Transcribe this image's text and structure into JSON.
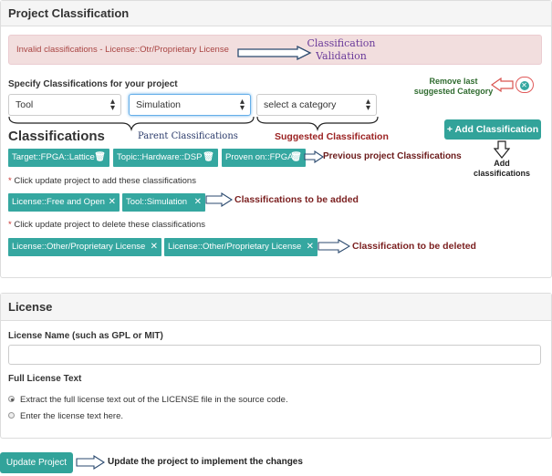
{
  "panel": {
    "title": "Project Classification",
    "alert_text": "Invalid classifications - License::Otr/Proprietary License",
    "specify_label": "Specify Classifications for your project",
    "selects": [
      {
        "value": "Tool"
      },
      {
        "value": "Simulation"
      },
      {
        "value": "select a category"
      }
    ],
    "classifications_heading": "Classifications",
    "add_button": "+ Add Classification",
    "previous_tags": [
      "Target::FPGA::Lattice",
      "Topic::Hardware::DSP",
      "Proven on::FPGA"
    ],
    "note_add": "Click update project to add these classifications",
    "add_tags": [
      "License::Free and Open",
      "Tool::Simulation"
    ],
    "note_delete": "Click update project to delete these classifications",
    "delete_tags": [
      "License::Other/Proprietary License",
      "License::Other/Proprietary License"
    ]
  },
  "annotations": {
    "validation": "Classification Validation",
    "validation_line1": "Classification",
    "validation_line2": "Validation",
    "remove_last": "Remove last suggested Category",
    "remove_last_line1": "Remove last",
    "remove_last_line2": "suggested Category",
    "parent": "Parent Classifications",
    "suggested": "Suggested Classification",
    "add_classifications": "Add classifications",
    "add_line1": "Add",
    "add_line2": "classifications",
    "previous": "Previous project Classifications",
    "to_be_added": "Classifications to be added",
    "to_be_deleted": "Classification to be deleted",
    "update": "Update the project to implement the changes"
  },
  "license": {
    "title": "License",
    "name_label": "License Name (such as GPL or MIT)",
    "name_value": "",
    "full_text_label": "Full License Text",
    "options": [
      {
        "label": "Extract the full license text out of the LICENSE file in the source code.",
        "selected": true
      },
      {
        "label": "Enter the license text here.",
        "selected": false
      }
    ]
  },
  "update_button": "Update Project",
  "colors": {
    "accent": "#35a7a0",
    "alert_bg": "#f2dede",
    "alert_text": "#a94442",
    "required_star": "#c9302c"
  }
}
